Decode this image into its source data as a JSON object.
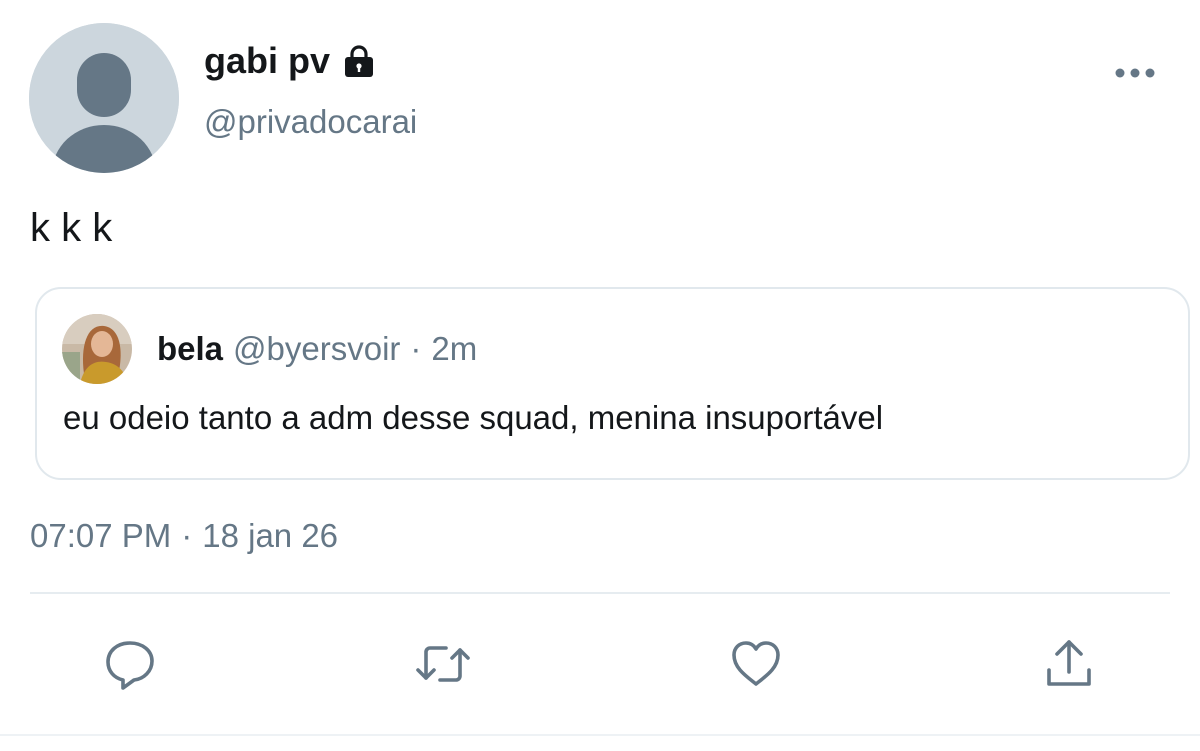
{
  "tweet": {
    "author": {
      "display_name": "gabi pv",
      "handle": "@privadocarai",
      "avatar_icon": "default-avatar-icon",
      "protected_icon": "lock-icon"
    },
    "text": "k k k",
    "timestamp": {
      "time": "07:07 PM",
      "separator": "·",
      "date": "18 jan 26"
    }
  },
  "quoted_tweet": {
    "author": {
      "display_name": "bela",
      "handle": "@byersvoir",
      "avatar_icon": "profile-photo-avatar"
    },
    "separator": "·",
    "relative_time": "2m",
    "text": "eu odeio tanto a adm desse squad, menina insuportável"
  },
  "actions": [
    {
      "name": "reply",
      "icon": "reply-icon"
    },
    {
      "name": "retweet",
      "icon": "retweet-icon"
    },
    {
      "name": "like",
      "icon": "heart-icon"
    },
    {
      "name": "share",
      "icon": "share-icon"
    }
  ],
  "colors": {
    "text_primary": "#14171a",
    "text_secondary": "#657786",
    "avatar_bg": "#ccd6dd",
    "avatar_figure": "#657786",
    "border": "#e1e8ed"
  }
}
